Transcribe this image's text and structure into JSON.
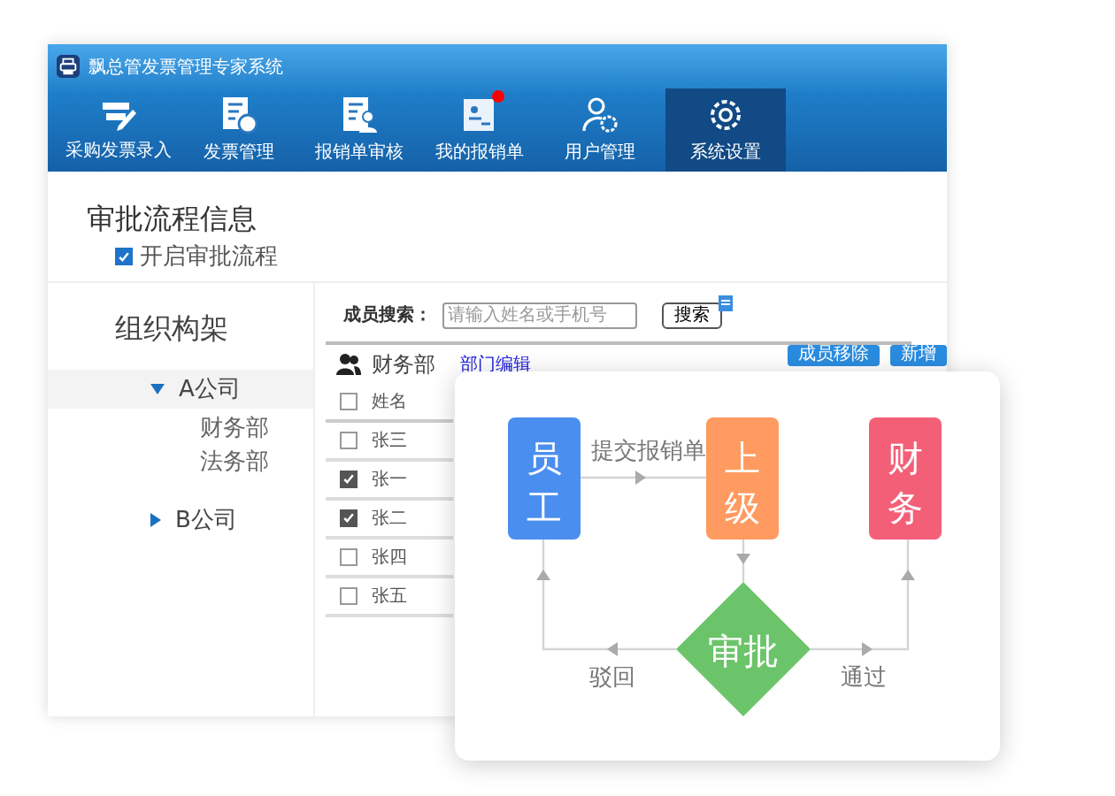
{
  "window": {
    "title": "飘总管发票管理专家系统"
  },
  "nav": [
    {
      "label": "采购发票录入",
      "selected": false,
      "badge": false
    },
    {
      "label": "发票管理",
      "selected": false,
      "badge": false
    },
    {
      "label": "报销单审核",
      "selected": false,
      "badge": false
    },
    {
      "label": "我的报销单",
      "selected": false,
      "badge": true
    },
    {
      "label": "用户管理",
      "selected": false,
      "badge": false
    },
    {
      "label": "系统设置",
      "selected": true,
      "badge": false
    }
  ],
  "section_title": "审批流程信息",
  "approval_enabled": {
    "label": "开启审批流程",
    "checked": true
  },
  "org": {
    "title": "组织构架",
    "tree": [
      {
        "label": "A公司",
        "expanded": true,
        "selected": true,
        "children": [
          {
            "label": "财务部"
          },
          {
            "label": "法务部"
          }
        ]
      },
      {
        "label": "B公司",
        "expanded": false,
        "selected": false
      }
    ]
  },
  "member_search": {
    "label": "成员搜索：",
    "placeholder": "请输入姓名或手机号",
    "button": "搜索"
  },
  "department": {
    "name": "财务部",
    "link": "部门编辑",
    "buttons": [
      "成员移除",
      "新增"
    ]
  },
  "table": {
    "columns": [
      "姓名"
    ],
    "header_checked": false,
    "rows": [
      {
        "name": "张三",
        "checked": false
      },
      {
        "name": "张一",
        "checked": true
      },
      {
        "name": "张二",
        "checked": true
      },
      {
        "name": "张四",
        "checked": false
      },
      {
        "name": "张五",
        "checked": false
      }
    ]
  },
  "flow": {
    "nodes": [
      {
        "label": "员工",
        "color": "#4a8ef0"
      },
      {
        "label": "上级",
        "color": "#ff9a60"
      },
      {
        "label": "财务",
        "color": "#f45f78"
      }
    ],
    "decision": {
      "label": "审批",
      "color": "#6cc46a"
    },
    "edges": [
      "提交报销单",
      "驳回",
      "通过"
    ]
  }
}
